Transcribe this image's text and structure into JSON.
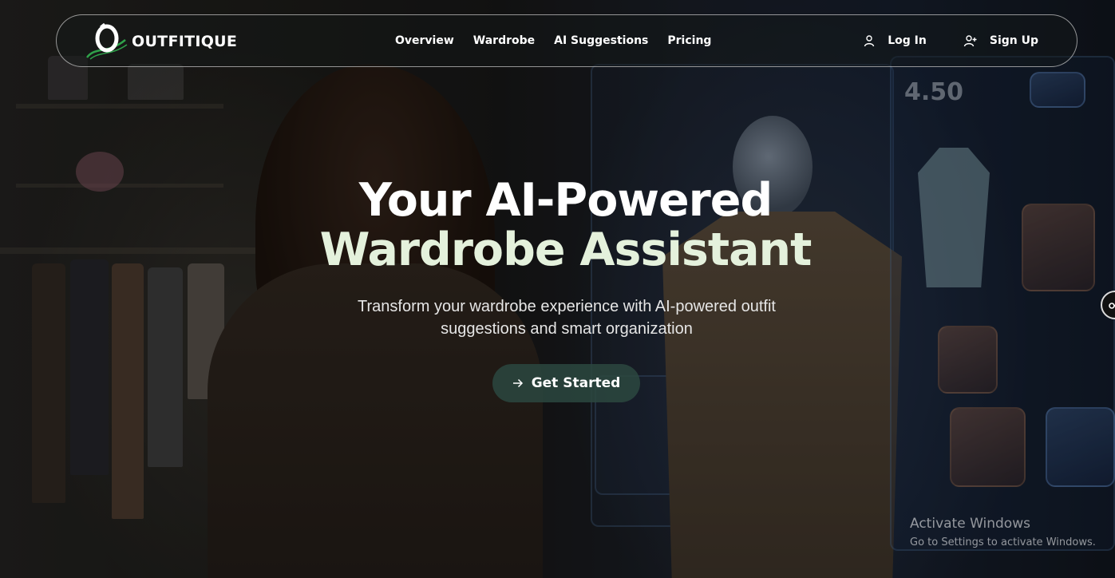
{
  "brand": {
    "name": "OUTFITIQUE",
    "logo_letter": "O",
    "accent_color": "#2fa24a"
  },
  "nav": {
    "links": [
      {
        "label": "Overview"
      },
      {
        "label": "Wardrobe"
      },
      {
        "label": "AI Suggestions"
      },
      {
        "label": "Pricing"
      }
    ]
  },
  "auth": {
    "login": {
      "label": "Log In",
      "icon": "user-icon"
    },
    "signup": {
      "label": "Sign Up",
      "icon": "user-plus-icon"
    }
  },
  "hero": {
    "title_line1": "Your AI-Powered",
    "title_line2": "Wardrobe Assistant",
    "subtitle": "Transform your wardrobe experience with AI-powered outfit suggestions and smart organization",
    "cta": {
      "label": "Get Started",
      "icon": "arrow-right-icon"
    },
    "title_color": "#ffffff",
    "highlight_color": "#e4f1dc"
  },
  "background": {
    "price_tag": "4.50"
  },
  "side_widget": {
    "icon": "accessibility-icon"
  },
  "watermark": {
    "title": "Activate Windows",
    "subtitle": "Go to Settings to activate Windows."
  }
}
